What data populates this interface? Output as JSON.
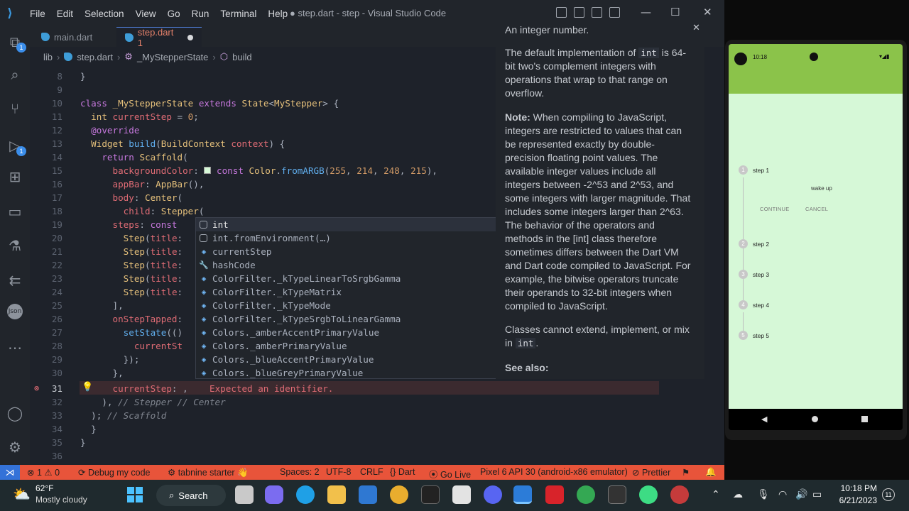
{
  "vscode": {
    "menu": [
      "File",
      "Edit",
      "Selection",
      "View",
      "Go",
      "Run",
      "Terminal",
      "Help"
    ],
    "window_title": "● step.dart - step - Visual Studio Code",
    "tabs": [
      {
        "label": "main.dart"
      },
      {
        "label": "step.dart 1"
      }
    ],
    "breadcrumb": [
      "lib",
      "step.dart",
      "_MyStepperState",
      "build"
    ],
    "activity_badges": {
      "explorer": "1",
      "debug": "1"
    }
  },
  "editor": {
    "line_numbers": [
      "8",
      "9",
      "10",
      "11",
      "12",
      "13",
      "14",
      "15",
      "16",
      "17",
      "18",
      "19",
      "20",
      "21",
      "22",
      "23",
      "24",
      "25",
      "26",
      "27",
      "28",
      "29",
      "30",
      "31",
      "32",
      "33",
      "34",
      "35",
      "36"
    ],
    "current_line": "31",
    "error_message": "Expected an identifier."
  },
  "suggestions": [
    {
      "label": "int",
      "icon": "class-icon"
    },
    {
      "label": "int.fromEnvironment(…)",
      "icon": "class-icon"
    },
    {
      "label": "currentStep",
      "icon": "field-icon"
    },
    {
      "label": "hashCode",
      "icon": "wrench-icon"
    },
    {
      "label": "ColorFilter._kTypeLinearToSrgbGamma",
      "icon": "field-icon"
    },
    {
      "label": "ColorFilter._kTypeMatrix",
      "icon": "field-icon"
    },
    {
      "label": "ColorFilter._kTypeMode",
      "icon": "field-icon"
    },
    {
      "label": "ColorFilter._kTypeSrgbToLinearGamma",
      "icon": "field-icon"
    },
    {
      "label": "Colors._amberAccentPrimaryValue",
      "icon": "field-icon"
    },
    {
      "label": "Colors._amberPrimaryValue",
      "icon": "field-icon"
    },
    {
      "label": "Colors._blueAccentPrimaryValue",
      "icon": "field-icon"
    },
    {
      "label": "Colors._blueGreyPrimaryValue",
      "icon": "field-icon"
    }
  ],
  "doc": {
    "p1": "An integer number.",
    "p2a": "The default implementation of ",
    "p2code": "int",
    "p2b": " is 64-bit two's complement integers with operations that wrap to that range on overflow.",
    "p3bold": "Note:",
    "p3": " When compiling to JavaScript, integers are restricted to values that can be represented exactly by double-precision floating point values. The available integer values include all integers between -2^53 and 2^53, and some integers with larger magnitude. That includes some integers larger than 2^63. The behavior of the operators and methods in the [int] class therefore sometimes differs between the Dart VM and Dart code compiled to JavaScript. For example, the bitwise operators truncate their operands to 32-bit integers when compiled to JavaScript.",
    "p4a": "Classes cannot extend, implement, or mix in ",
    "p4code": "int",
    "p4b": ".",
    "see_also": "See also:"
  },
  "statusbar": {
    "errors": "1",
    "warnings": "0",
    "debug": "Debug my code",
    "tabnine": "tabnine starter",
    "spaces": "Spaces: 2",
    "encoding": "UTF-8",
    "eol": "CRLF",
    "language": "Dart",
    "golive": "Go Live",
    "device": "Pixel 6 API 30 (android-x86 emulator)",
    "prettier": "Prettier"
  },
  "emulator": {
    "clock": "10:18",
    "steps": [
      {
        "num": "1",
        "title": "step 1"
      },
      {
        "num": "2",
        "title": "step 2"
      },
      {
        "num": "3",
        "title": "step 3"
      },
      {
        "num": "4",
        "title": "step 4"
      },
      {
        "num": "5",
        "title": "step 5"
      }
    ],
    "content": "wake up",
    "continue_label": "CONTINUE",
    "cancel_label": "CANCEL",
    "colors": {
      "appbar": "#8bc34a",
      "background": "#d6f8d7"
    }
  },
  "taskbar": {
    "temperature": "62°F",
    "weather": "Mostly cloudy",
    "search": "Search",
    "time": "10:18 PM",
    "date": "6/21/2023",
    "notifications": "11"
  }
}
